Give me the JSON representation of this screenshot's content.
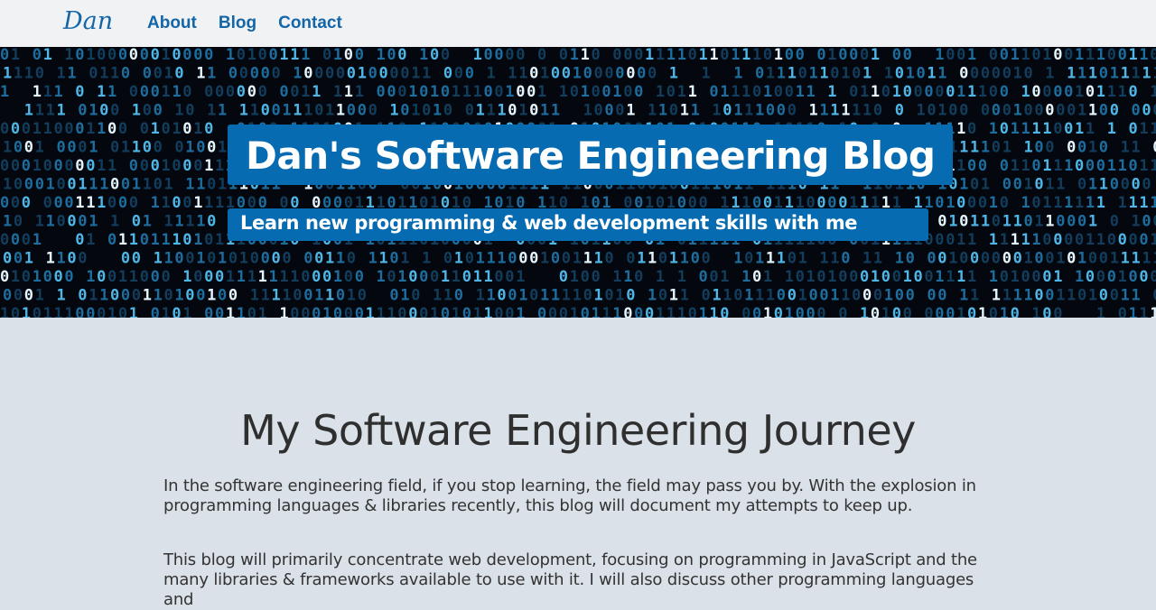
{
  "nav": {
    "logo": "Dan",
    "links": [
      "About",
      "Blog",
      "Contact"
    ],
    "accent_color": "#1366a8"
  },
  "hero": {
    "title": "Dan's Software Engineering Blog",
    "subtitle": "Learn new programming & web development skills with me",
    "background": "binary-code-matrix",
    "box_color": "#066bb0"
  },
  "main": {
    "heading": "My Software Engineering Journey",
    "paragraphs": [
      "In the software engineering field, if you stop learning, the field may pass you by. With the explosion in programming languages & libraries recently, this blog will document my attempts to keep up.",
      "This blog will primarily concentrate web development, focusing on programming in JavaScript and the many libraries & frameworks available to use with it. I will also discuss other programming languages and"
    ]
  }
}
